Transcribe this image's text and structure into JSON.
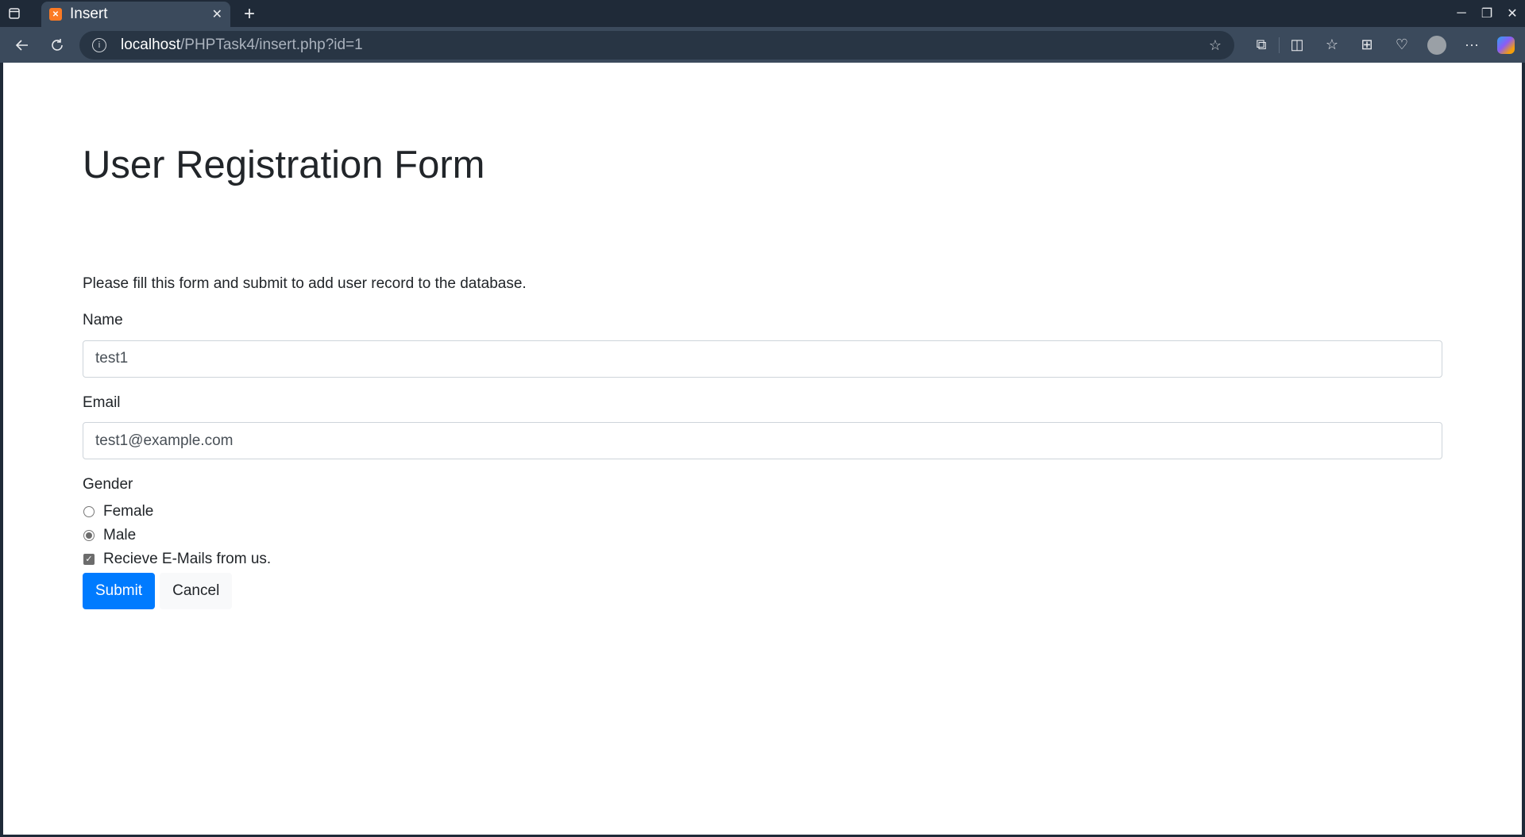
{
  "browser": {
    "tab": {
      "title": "Insert",
      "close_glyph": "✕"
    },
    "new_tab_glyph": "+",
    "url": {
      "host": "localhost",
      "path": "/PHPTask4/insert.php?id=1"
    },
    "window_controls": {
      "minimize": "─",
      "restore": "❐",
      "close": "✕"
    }
  },
  "page": {
    "title": "User Registration Form",
    "intro": "Please fill this form and submit to add user record to the database.",
    "name": {
      "label": "Name",
      "value": "test1"
    },
    "email": {
      "label": "Email",
      "value": "test1@example.com"
    },
    "gender": {
      "label": "Gender",
      "options": [
        {
          "label": "Female",
          "checked": false
        },
        {
          "label": "Male",
          "checked": true
        }
      ]
    },
    "newsletter": {
      "label": "Recieve E-Mails from us.",
      "checked": true
    },
    "submit_label": "Submit",
    "cancel_label": "Cancel"
  },
  "colors": {
    "primary": "#007bff",
    "browser_frame": "#1f2a38",
    "toolbar": "#3b4a5c"
  }
}
